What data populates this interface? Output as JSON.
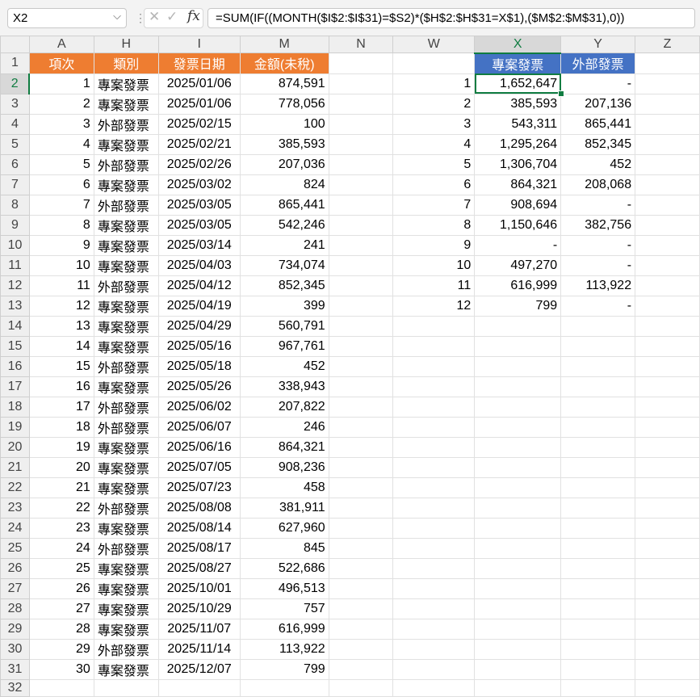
{
  "formula_bar": {
    "name_box": "X2",
    "name_box_arrow": "⌵",
    "separator": "⋮",
    "cancel_glyph": "✕",
    "enter_glyph": "✓",
    "fx_label": "fx",
    "formula": "=SUM(IF((MONTH($I$2:$I$31)=$S2)*($H$2:$H$31=X$1),($M$2:$M$31),0))"
  },
  "columns": [
    "A",
    "H",
    "I",
    "M",
    "N",
    "W",
    "X",
    "Y",
    "Z"
  ],
  "selected_column": "X",
  "selected_row": 2,
  "active_cell": "X2",
  "row_numbers": [
    1,
    2,
    3,
    4,
    5,
    6,
    7,
    8,
    9,
    10,
    11,
    12,
    13,
    14,
    15,
    16,
    17,
    18,
    19,
    20,
    21,
    22,
    23,
    24,
    25,
    26,
    27,
    28,
    29,
    30,
    31,
    32
  ],
  "left_table": {
    "headers": [
      "項次",
      "類別",
      "發票日期",
      "金額(未稅)"
    ],
    "rows": [
      [
        "1",
        "專案發票",
        "2025/01/06",
        "874,591"
      ],
      [
        "2",
        "專案發票",
        "2025/01/06",
        "778,056"
      ],
      [
        "3",
        "外部發票",
        "2025/02/15",
        "100"
      ],
      [
        "4",
        "專案發票",
        "2025/02/21",
        "385,593"
      ],
      [
        "5",
        "外部發票",
        "2025/02/26",
        "207,036"
      ],
      [
        "6",
        "專案發票",
        "2025/03/02",
        "824"
      ],
      [
        "7",
        "外部發票",
        "2025/03/05",
        "865,441"
      ],
      [
        "8",
        "專案發票",
        "2025/03/05",
        "542,246"
      ],
      [
        "9",
        "專案發票",
        "2025/03/14",
        "241"
      ],
      [
        "10",
        "專案發票",
        "2025/04/03",
        "734,074"
      ],
      [
        "11",
        "外部發票",
        "2025/04/12",
        "852,345"
      ],
      [
        "12",
        "專案發票",
        "2025/04/19",
        "399"
      ],
      [
        "13",
        "專案發票",
        "2025/04/29",
        "560,791"
      ],
      [
        "14",
        "專案發票",
        "2025/05/16",
        "967,761"
      ],
      [
        "15",
        "外部發票",
        "2025/05/18",
        "452"
      ],
      [
        "16",
        "專案發票",
        "2025/05/26",
        "338,943"
      ],
      [
        "17",
        "外部發票",
        "2025/06/02",
        "207,822"
      ],
      [
        "18",
        "外部發票",
        "2025/06/07",
        "246"
      ],
      [
        "19",
        "專案發票",
        "2025/06/16",
        "864,321"
      ],
      [
        "20",
        "專案發票",
        "2025/07/05",
        "908,236"
      ],
      [
        "21",
        "專案發票",
        "2025/07/23",
        "458"
      ],
      [
        "22",
        "外部發票",
        "2025/08/08",
        "381,911"
      ],
      [
        "23",
        "專案發票",
        "2025/08/14",
        "627,960"
      ],
      [
        "24",
        "外部發票",
        "2025/08/17",
        "845"
      ],
      [
        "25",
        "專案發票",
        "2025/08/27",
        "522,686"
      ],
      [
        "26",
        "專案發票",
        "2025/10/01",
        "496,513"
      ],
      [
        "27",
        "專案發票",
        "2025/10/29",
        "757"
      ],
      [
        "28",
        "專案發票",
        "2025/11/07",
        "616,999"
      ],
      [
        "29",
        "外部發票",
        "2025/11/14",
        "113,922"
      ],
      [
        "30",
        "專案發票",
        "2025/12/07",
        "799"
      ]
    ]
  },
  "right_table": {
    "headers": [
      "專案發票",
      "外部發票"
    ],
    "rows": [
      [
        "1",
        "1,652,647",
        "-"
      ],
      [
        "2",
        "385,593",
        "207,136"
      ],
      [
        "3",
        "543,311",
        "865,441"
      ],
      [
        "4",
        "1,295,264",
        "852,345"
      ],
      [
        "5",
        "1,306,704",
        "452"
      ],
      [
        "6",
        "864,321",
        "208,068"
      ],
      [
        "7",
        "908,694",
        "-"
      ],
      [
        "8",
        "1,150,646",
        "382,756"
      ],
      [
        "9",
        "-",
        "-"
      ],
      [
        "10",
        "497,270",
        "-"
      ],
      [
        "11",
        "616,999",
        "113,922"
      ],
      [
        "12",
        "799",
        "-"
      ]
    ]
  },
  "colors": {
    "header_orange": "#ee7d31",
    "header_blue": "#4472c4",
    "selection_green": "#107c41"
  }
}
